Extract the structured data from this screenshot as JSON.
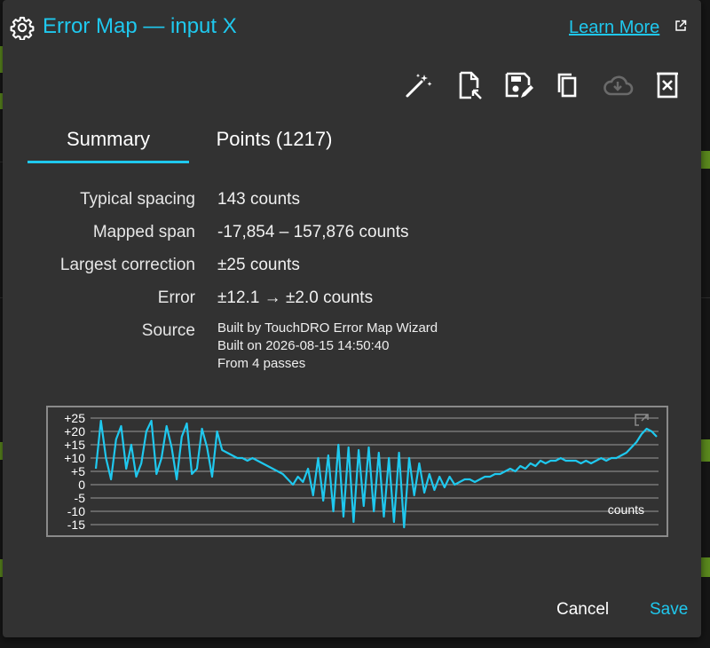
{
  "dialog": {
    "title": "Error Map — input X",
    "learn_more": "Learn More"
  },
  "toolbar": [
    {
      "name": "wizard",
      "icon": "magic-wand-icon",
      "enabled": true
    },
    {
      "name": "import",
      "icon": "file-import-icon",
      "enabled": true
    },
    {
      "name": "save-file",
      "icon": "save-edit-icon",
      "enabled": true
    },
    {
      "name": "copy",
      "icon": "copy-icon",
      "enabled": true
    },
    {
      "name": "cloud-download",
      "icon": "cloud-download-icon",
      "enabled": false
    },
    {
      "name": "delete",
      "icon": "delete-icon",
      "enabled": true
    }
  ],
  "tabs": {
    "summary": "Summary",
    "points": "Points (1217)",
    "active": "summary"
  },
  "summary": {
    "typical_spacing": {
      "label": "Typical spacing",
      "value": "143 counts"
    },
    "mapped_span": {
      "label": "Mapped span",
      "value": "-17,854 – 157,876 counts"
    },
    "largest_correction": {
      "label": "Largest correction",
      "value": "±25 counts"
    },
    "error": {
      "label": "Error",
      "value": "±12.1 → ±2.0 counts"
    },
    "source": {
      "label": "Source",
      "lines": [
        "Built by TouchDRO Error Map Wizard",
        "Built on 2026-08-15 14:50:40",
        "From 4 passes"
      ]
    }
  },
  "chart_data": {
    "type": "line",
    "ytick_labels": [
      "+25",
      "+20",
      "+15",
      "+10",
      "+5",
      "0",
      "-5",
      "-10",
      "-15"
    ],
    "ylim": [
      -17,
      25
    ],
    "unit_label": "counts",
    "series_color": "#1fc8ee",
    "grid": true,
    "series": [
      {
        "values": [
          6,
          24,
          10,
          2,
          17,
          22,
          6,
          15,
          3,
          8,
          20,
          24,
          4,
          10,
          22,
          14,
          2,
          18,
          23,
          4,
          6,
          21,
          14,
          3,
          20,
          13,
          12,
          11,
          10,
          10,
          9,
          10,
          9,
          8,
          7,
          6,
          5,
          4,
          2,
          0,
          3,
          1,
          6,
          -4,
          10,
          -6,
          11,
          -10,
          15,
          -12,
          14,
          -14,
          13,
          -8,
          14,
          -10,
          12,
          -12,
          10,
          -14,
          12,
          -16,
          10,
          -4,
          8,
          -3,
          4,
          -2,
          3,
          -1,
          3,
          0,
          1,
          2,
          2,
          1,
          2,
          3,
          3,
          4,
          4,
          5,
          6,
          5,
          7,
          6,
          8,
          7,
          9,
          8,
          9,
          9,
          10,
          9,
          9,
          9,
          8,
          9,
          8,
          9,
          10,
          9,
          10,
          10,
          11,
          12,
          14,
          16,
          19,
          21,
          20,
          18
        ]
      }
    ]
  },
  "footer": {
    "cancel": "Cancel",
    "save": "Save"
  },
  "colors": {
    "accent": "#1fc8ee",
    "dialog_bg": "#323232",
    "text": "#ffffff",
    "disabled": "#6a6a6a"
  }
}
